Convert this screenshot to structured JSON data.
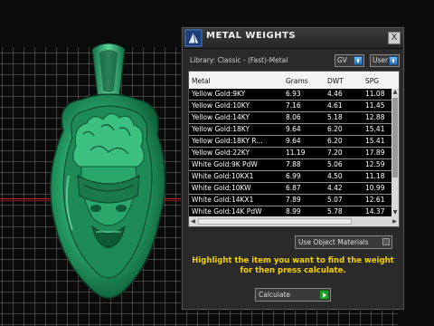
{
  "window": {
    "title": "METAL WEIGHTS",
    "close_label": "X",
    "icon": "rhino-cone-icon"
  },
  "library": {
    "label": "Library: Classic - (Fast)-Metal"
  },
  "toggles": {
    "gv_label": "GV",
    "user_label": "User"
  },
  "table": {
    "headers": [
      "Metal",
      "Grams",
      "DWT",
      "SPG"
    ],
    "rows": [
      [
        "Yellow Gold:9KY",
        "6.93",
        "4.46",
        "11.08"
      ],
      [
        "Yellow Gold:10KY",
        "7.16",
        "4.61",
        "11.45"
      ],
      [
        "Yellow Gold:14KY",
        "8.06",
        "5.18",
        "12.88"
      ],
      [
        "Yellow Gold:18KY",
        "9.64",
        "6.20",
        "15.41"
      ],
      [
        "Yellow Gold:18KY R...",
        "9.64",
        "6.20",
        "15.41"
      ],
      [
        "Yellow Gold:22KY",
        "11.19",
        "7.20",
        "17.89"
      ],
      [
        "White Gold:9K PdW",
        "7.88",
        "5.06",
        "12.59"
      ],
      [
        "White Gold:10KX1",
        "6.99",
        "4.50",
        "11.18"
      ],
      [
        "White Gold:10KW",
        "6.87",
        "4.42",
        "10.99"
      ],
      [
        "White Gold:14KX1",
        "7.89",
        "5.07",
        "12.61"
      ],
      [
        "White Gold:14K PdW",
        "8.99",
        "5.78",
        "14.37"
      ]
    ]
  },
  "controls": {
    "use_object_materials_label": "Use Object Materials",
    "calculate_label": "Calculate"
  },
  "instruction": {
    "text": "Highlight the item you want to find the weight for then press calculate."
  },
  "colors": {
    "accent_text": "#f3d100",
    "pendant_green": "#2aa86b",
    "go_button": "#1f9d2a",
    "toggle_blue": "#3b8fe0"
  }
}
